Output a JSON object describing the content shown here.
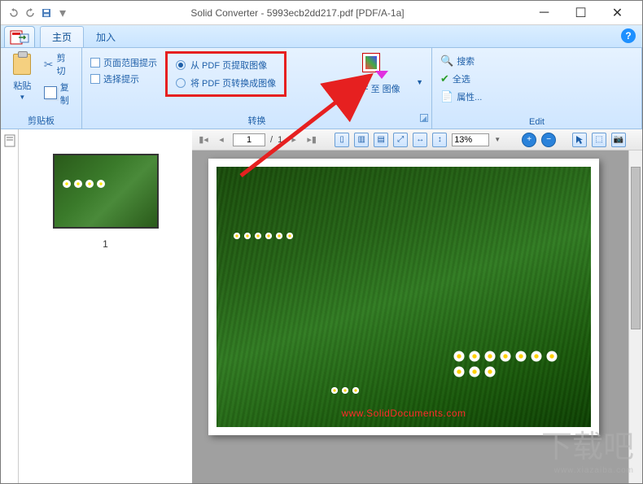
{
  "titlebar": {
    "app_name": "Solid Converter",
    "doc_name": "5993ecb2dd217.pdf",
    "doc_tag": "[PDF/A-1a]",
    "full_title": "Solid Converter - 5993ecb2dd217.pdf [PDF/A-1a]"
  },
  "tabs": {
    "home": "主页",
    "add": "加入"
  },
  "ribbon": {
    "clipboard": {
      "group": "剪贴板",
      "paste": "粘贴",
      "cut": "剪切",
      "copy": "复制"
    },
    "convert": {
      "group": "转换",
      "page_range_hint": "页面范围提示",
      "select_hint": "选择提示",
      "radio_extract": "从 PDF 页提取图像",
      "radio_convert": "将 PDF 页转换成图像",
      "pdf_to_image": "PDF 至 图像"
    },
    "edit": {
      "group": "Edit",
      "search": "搜索",
      "select_all": "全选",
      "properties": "属性..."
    }
  },
  "viewer": {
    "page_current": "1",
    "page_sep": "/",
    "page_total": "1",
    "zoom": "13%"
  },
  "thumbnail": {
    "page_num": "1"
  },
  "photo": {
    "watermark": "www.SolidDocuments.com"
  },
  "site_watermark": {
    "main": "下载吧",
    "sub": "www.xiazaiba.com"
  }
}
